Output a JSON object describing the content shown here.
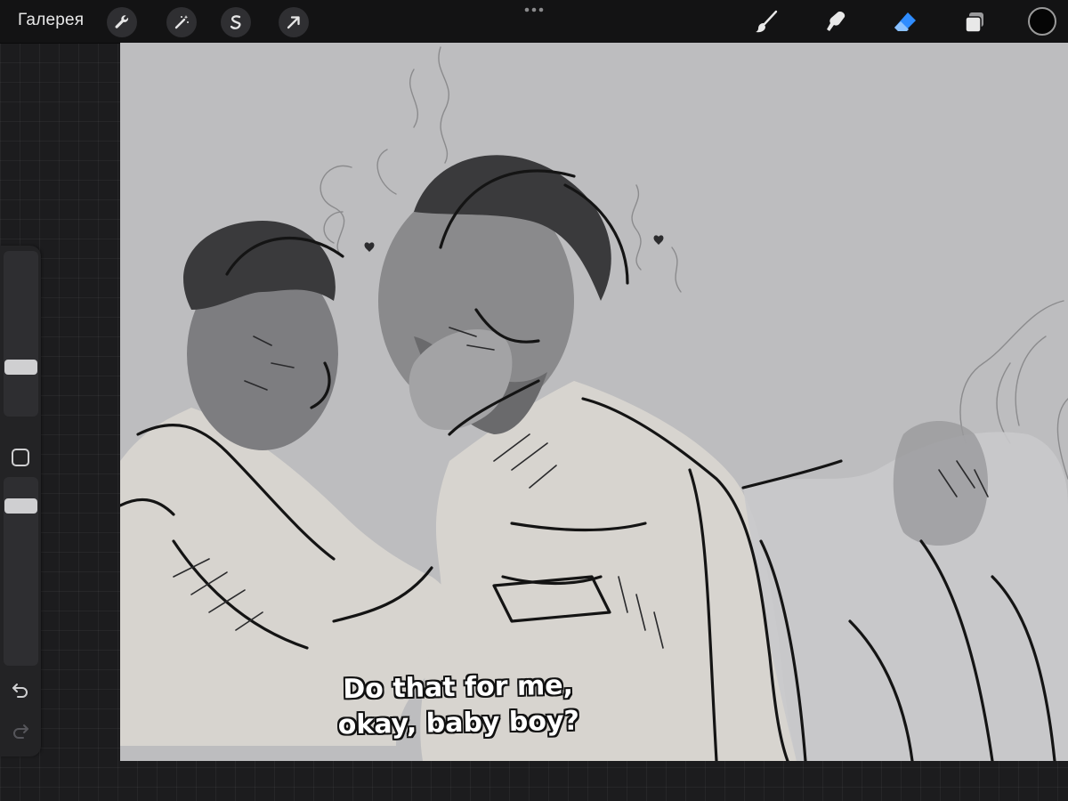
{
  "app": {
    "gallery_label": "Галерея"
  },
  "toolbar": {
    "left_icons": [
      "wrench-icon",
      "magic-wand-icon",
      "selection-icon",
      "transform-arrow-icon"
    ],
    "right_tools": [
      "brush-icon",
      "smudge-icon",
      "eraser-icon",
      "layers-icon"
    ],
    "active_tool": "eraser",
    "active_color": "#000000",
    "accent_color": "#2f8cff"
  },
  "sidebar": {
    "size_slider_level": 0.35,
    "opacity_slider_level": 0.9,
    "modify_button": "square-modify-icon",
    "undo": "undo-icon",
    "redo": "redo-icon"
  },
  "canvas": {
    "caption_line1": "Do that  for me,",
    "caption_line2": "okay, baby boy?",
    "background_color": "#bdbdbf"
  }
}
